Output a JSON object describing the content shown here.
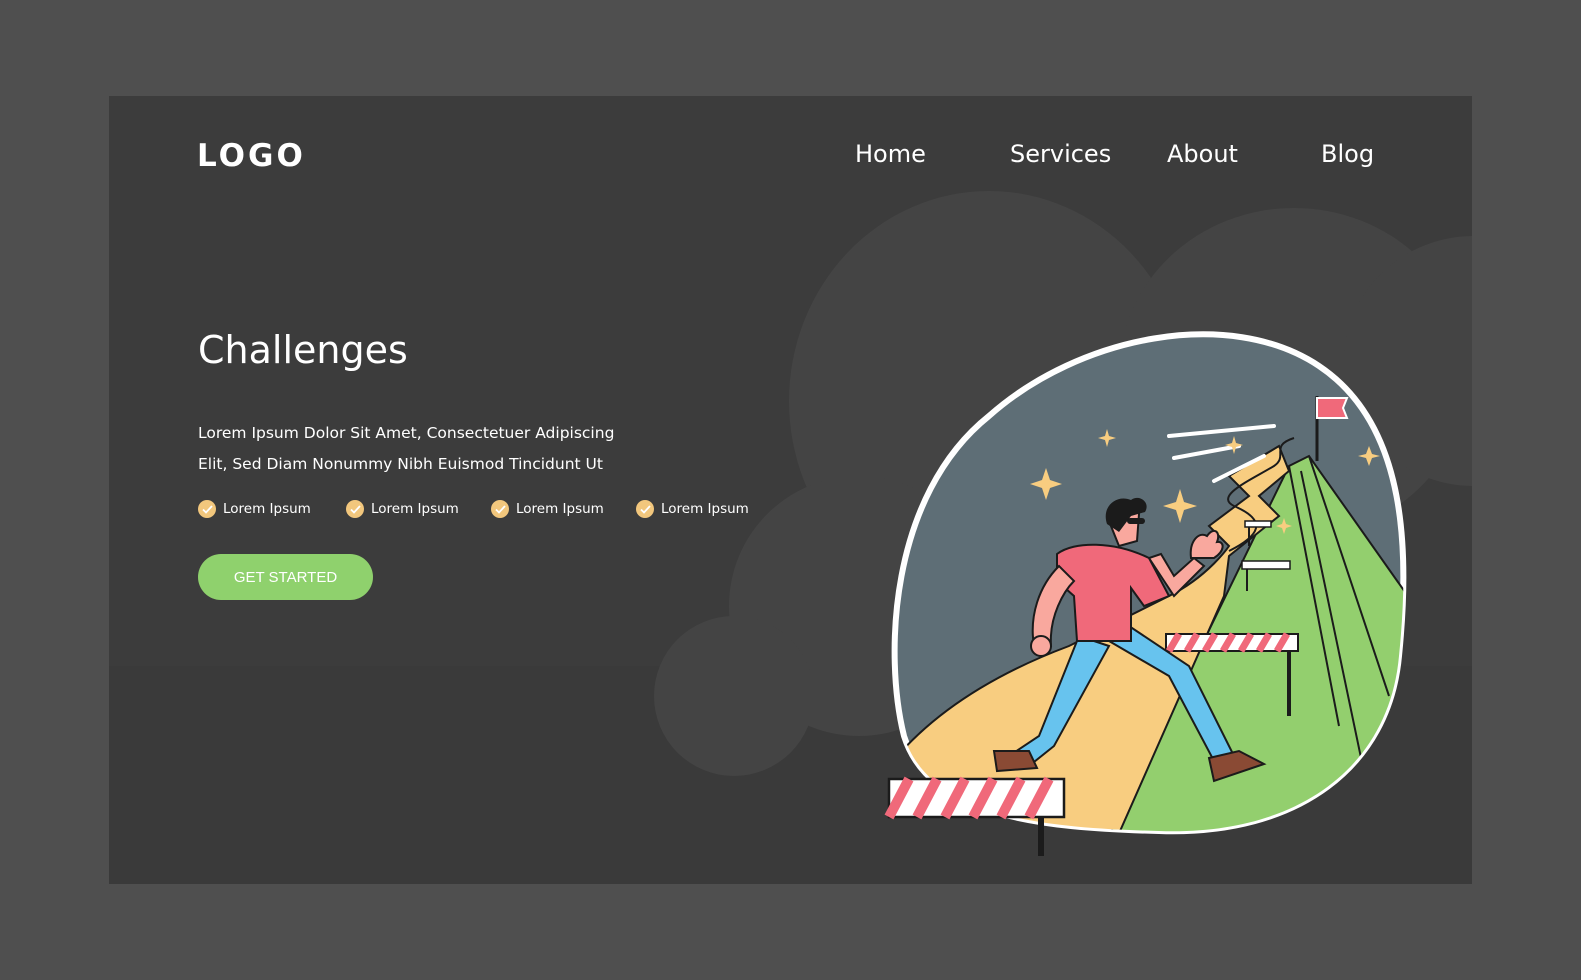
{
  "header": {
    "logo": "LOGO",
    "nav": [
      "Home",
      "Services",
      "About",
      "Blog"
    ]
  },
  "hero": {
    "title": "Challenges",
    "description_line1": "Lorem Ipsum Dolor Sit Amet, Consectetuer Adipiscing",
    "description_line2": "Elit, Sed Diam Nonummy Nibh Euismod Tincidunt Ut",
    "features": [
      "Lorem Ipsum",
      "Lorem Ipsum",
      "Lorem Ipsum",
      "Lorem Ipsum"
    ],
    "cta_label": "GET STARTED"
  },
  "colors": {
    "page_bg": "#4f4f4f",
    "card_bg": "#3a3a3a",
    "accent_green": "#8fd16d",
    "check_yellow": "#f2c77d",
    "shirt_pink": "#f0697a",
    "pants_blue": "#67c3ee",
    "mountain_green": "#93cf6e",
    "path_yellow": "#f8cd80",
    "sky_slate": "#5e6e76"
  },
  "icons": {
    "check": "check-circle-icon",
    "flag": "flag-icon",
    "sparkle": "sparkle-icon"
  }
}
